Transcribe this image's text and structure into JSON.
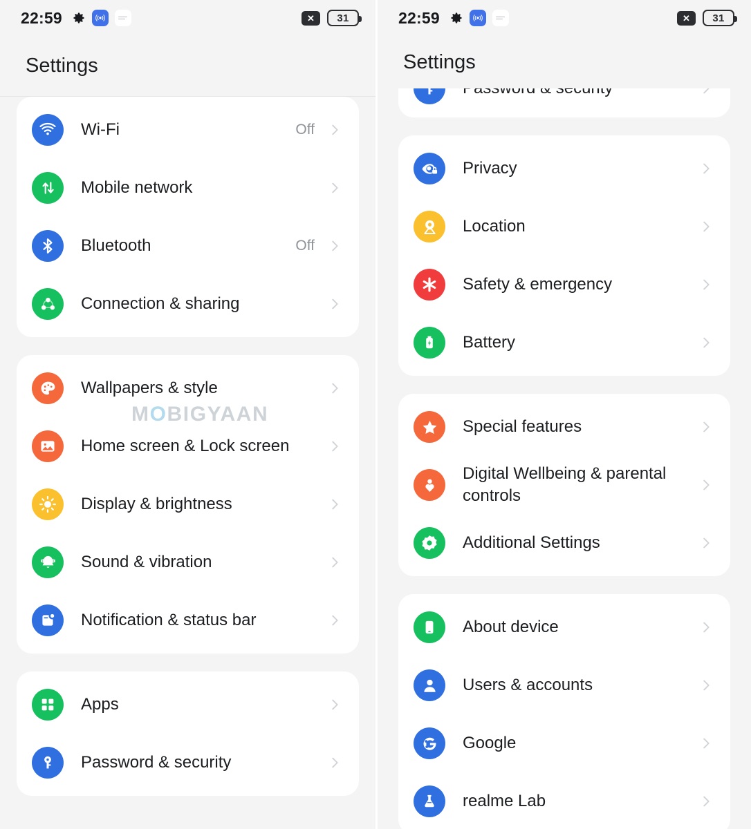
{
  "statusbar": {
    "time": "22:59",
    "icons": [
      "gear-icon",
      "broadcast-icon",
      "notification-lines-icon"
    ],
    "mute_label": "✕",
    "battery_level": "31"
  },
  "header": {
    "title": "Settings"
  },
  "watermark": {
    "pre": "M",
    "o": "O",
    "post": "BIGYAAN",
    "full": "MOBIGYAAN"
  },
  "colors": {
    "blue": "#2f6fe0",
    "green": "#17c05e",
    "orange": "#f4683c",
    "yellow": "#fbc02d",
    "red": "#f03c3c",
    "page_bg": "#f4f4f4",
    "card_bg": "#ffffff",
    "text": "#1b1d20",
    "muted": "#8e9297"
  },
  "left_panel": {
    "groups": [
      {
        "rows": [
          {
            "label": "Wi-Fi",
            "value": "Off",
            "icon": "wifi-icon",
            "color": "#2f6fe0"
          },
          {
            "label": "Mobile network",
            "value": "",
            "icon": "mobile-network-icon",
            "color": "#17c05e"
          },
          {
            "label": "Bluetooth",
            "value": "Off",
            "icon": "bluetooth-icon",
            "color": "#2f6fe0"
          },
          {
            "label": "Connection & sharing",
            "value": "",
            "icon": "connection-sharing-icon",
            "color": "#17c05e"
          }
        ]
      },
      {
        "rows": [
          {
            "label": "Wallpapers & style",
            "value": "",
            "icon": "palette-icon",
            "color": "#f4683c"
          },
          {
            "label": "Home screen & Lock screen",
            "value": "",
            "icon": "image-icon",
            "color": "#f4683c"
          },
          {
            "label": "Display & brightness",
            "value": "",
            "icon": "brightness-icon",
            "color": "#fbc02d"
          },
          {
            "label": "Sound & vibration",
            "value": "",
            "icon": "bell-icon",
            "color": "#17c05e"
          },
          {
            "label": "Notification & status bar",
            "value": "",
            "icon": "notification-bar-icon",
            "color": "#2f6fe0"
          }
        ]
      },
      {
        "rows": [
          {
            "label": "Apps",
            "value": "",
            "icon": "apps-grid-icon",
            "color": "#17c05e"
          },
          {
            "label": "Password & security",
            "value": "",
            "icon": "key-icon",
            "color": "#2f6fe0"
          }
        ]
      }
    ]
  },
  "right_panel": {
    "clipped_row": {
      "label": "Password & security",
      "icon": "key-icon",
      "color": "#2f6fe0"
    },
    "groups": [
      {
        "rows": [
          {
            "label": "Privacy",
            "value": "",
            "icon": "privacy-eye-lock-icon",
            "color": "#2f6fe0"
          },
          {
            "label": "Location",
            "value": "",
            "icon": "location-pin-icon",
            "color": "#fbc02d"
          },
          {
            "label": "Safety & emergency",
            "value": "",
            "icon": "emergency-asterisk-icon",
            "color": "#f03c3c"
          },
          {
            "label": "Battery",
            "value": "",
            "icon": "battery-icon",
            "color": "#17c05e"
          }
        ]
      },
      {
        "rows": [
          {
            "label": "Special features",
            "value": "",
            "icon": "star-icon",
            "color": "#f4683c"
          },
          {
            "label": "Digital Wellbeing & parental controls",
            "value": "",
            "icon": "wellbeing-heart-icon",
            "color": "#f4683c"
          },
          {
            "label": "Additional Settings",
            "value": "",
            "icon": "additional-settings-gear-icon",
            "color": "#17c05e"
          }
        ]
      },
      {
        "rows": [
          {
            "label": "About device",
            "value": "",
            "icon": "phone-device-icon",
            "color": "#17c05e"
          },
          {
            "label": "Users & accounts",
            "value": "",
            "icon": "user-account-icon",
            "color": "#2f6fe0"
          },
          {
            "label": "Google",
            "value": "",
            "icon": "google-g-icon",
            "color": "#2f6fe0"
          },
          {
            "label": "realme Lab",
            "value": "",
            "icon": "flask-lab-icon",
            "color": "#2f6fe0"
          }
        ]
      }
    ]
  }
}
